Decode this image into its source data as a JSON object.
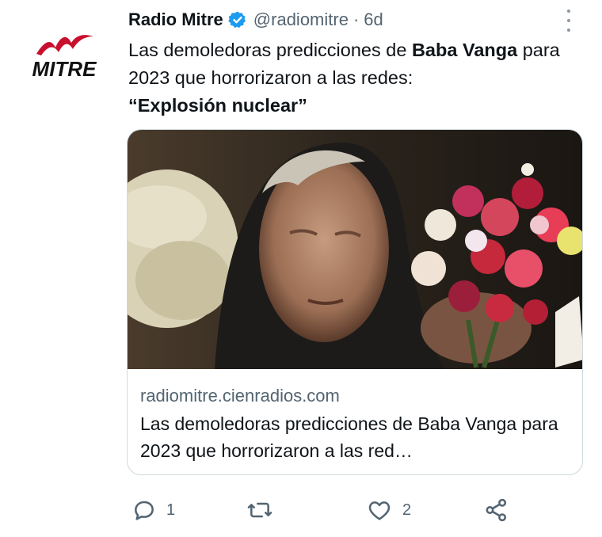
{
  "account": {
    "display_name": "Radio Mitre",
    "handle": "@radiomitre",
    "separator": "·",
    "time": "6d",
    "logo_text": "MITRE",
    "brand_color": "#c8102e",
    "verified_color": "#1d9bf0"
  },
  "tweet": {
    "part1": "Las demoledoras predicciones de ",
    "bold1": "Baba Vanga",
    "part2": " para 2023 que horrorizaron a las redes: ",
    "bold2": "“Explosión nuclear”"
  },
  "card": {
    "domain": "radiomitre.cienradios.com",
    "title": "Las demoledoras predicciones de Baba Vanga para 2023 que horrorizaron a las red…"
  },
  "actions": {
    "reply_count": "1",
    "retweet_count": "",
    "like_count": "2"
  },
  "icons": [
    "verified-badge-icon",
    "more-options-icon",
    "reply-icon",
    "retweet-icon",
    "like-icon",
    "share-icon"
  ]
}
